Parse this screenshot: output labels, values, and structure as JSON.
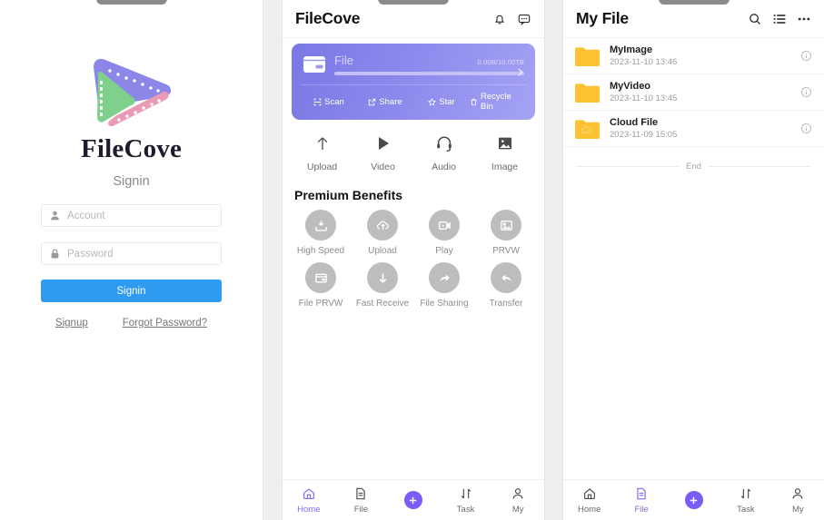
{
  "colors": {
    "accent_blue": "#2f9bf0",
    "accent_purple": "#7b5cf5",
    "card_gradient_start": "#7b77e4",
    "card_gradient_end": "#a5a3f3",
    "folder_yellow": "#fcc230",
    "benefit_grey": "#bdbdbd"
  },
  "signin": {
    "brand": "FileCove",
    "subtitle": "Signin",
    "account": {
      "placeholder": "Account",
      "value": "",
      "icon": "user-icon"
    },
    "password": {
      "placeholder": "Password",
      "value": "",
      "icon": "lock-icon"
    },
    "submit_label": "Signin",
    "signup_label": "Signup",
    "forgot_label": "Forgot Password?"
  },
  "home": {
    "title": "FileCove",
    "header_icons": [
      {
        "name": "bell-icon",
        "label": "Notifications"
      },
      {
        "name": "chat-icon",
        "label": "Messages"
      }
    ],
    "storage_card": {
      "label": "File",
      "quota": "0.00B/10.00TB",
      "progress_percent": 0,
      "chevron": "chevron-right-icon",
      "actions": [
        {
          "label": "Scan",
          "icon": "scan-icon"
        },
        {
          "label": "Share",
          "icon": "share-icon"
        },
        {
          "label": "Star",
          "icon": "star-icon"
        },
        {
          "label": "Recycle Bin",
          "icon": "trash-icon"
        }
      ]
    },
    "quick_actions": [
      {
        "label": "Upload",
        "icon": "arrow-up-icon"
      },
      {
        "label": "Video",
        "icon": "play-icon"
      },
      {
        "label": "Audio",
        "icon": "headset-icon"
      },
      {
        "label": "Image",
        "icon": "image-icon"
      }
    ],
    "benefits_title": "Premium Benefits",
    "benefits": [
      {
        "label": "High Speed",
        "icon": "download-box-icon"
      },
      {
        "label": "Upload",
        "icon": "cloud-upload-icon"
      },
      {
        "label": "Play",
        "icon": "video-play-icon"
      },
      {
        "label": "PRVW",
        "icon": "image-preview-icon"
      },
      {
        "label": "File PRVW",
        "icon": "folder-preview-icon"
      },
      {
        "label": "Fast Receive",
        "icon": "arrow-down-icon"
      },
      {
        "label": "File Sharing",
        "icon": "forward-arrow-icon"
      },
      {
        "label": "Transfer",
        "icon": "reply-arrow-icon"
      }
    ]
  },
  "myfile": {
    "title": "My File",
    "header_icons": [
      {
        "name": "search-icon",
        "label": "Search"
      },
      {
        "name": "list-icon",
        "label": "List view"
      },
      {
        "name": "more-icon",
        "label": "More"
      }
    ],
    "files": [
      {
        "name": "MyImage",
        "date": "2023-11-10 13:46",
        "icon": "folder-icon"
      },
      {
        "name": "MyVideo",
        "date": "2023-11-10 13:45",
        "icon": "folder-icon"
      },
      {
        "name": "Cloud File",
        "date": "2023-11-09 15:05",
        "icon": "cloud-folder-icon"
      }
    ],
    "end_label": "End"
  },
  "tabbar": {
    "home": "Home",
    "file": "File",
    "add": "",
    "task": "Task",
    "my": "My"
  }
}
